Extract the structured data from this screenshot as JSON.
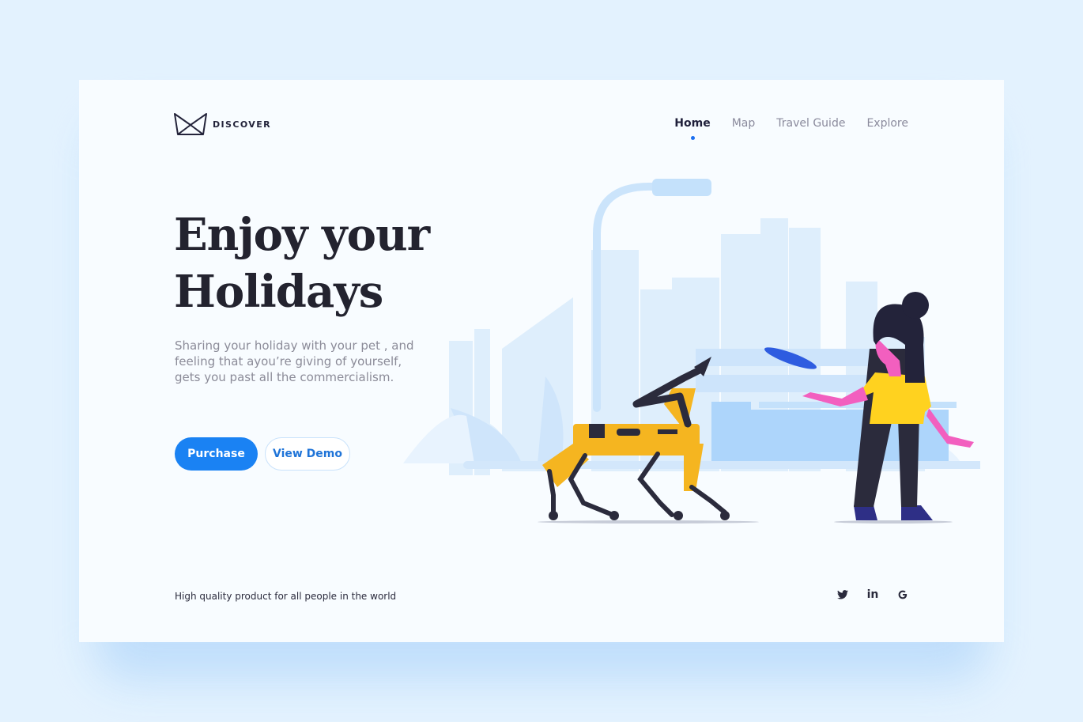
{
  "brand": {
    "name": "DISCOVER",
    "logo_icon": "crown-outline-icon"
  },
  "nav": {
    "items": [
      {
        "label": "Home",
        "active": true
      },
      {
        "label": "Map",
        "active": false
      },
      {
        "label": "Travel Guide",
        "active": false
      },
      {
        "label": "Explore",
        "active": false
      }
    ]
  },
  "hero": {
    "title_line1": "Enjoy your",
    "title_line2": "Holidays",
    "description": "Sharing your holiday with your pet , and feeling that ayou’re giving of yourself, gets you past all the commercialism.",
    "primary_button": "Purchase",
    "secondary_button": "View Demo"
  },
  "footer": {
    "tagline": "High quality product for all people in the world",
    "socials": [
      {
        "icon": "twitter-icon"
      },
      {
        "icon": "linkedin-icon",
        "glyph": "in"
      },
      {
        "icon": "google-icon"
      }
    ]
  },
  "colors": {
    "accent": "#1a82f3",
    "background": "#e3f2fe",
    "card": "#f8fcff",
    "robot_yellow": "#f5b520",
    "shirt_yellow": "#ffd21f",
    "skin_pink": "#f25fbf"
  }
}
